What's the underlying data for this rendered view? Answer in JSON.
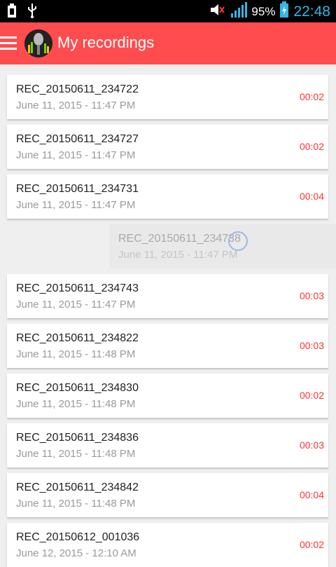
{
  "status_bar": {
    "icons": [
      "usb-storage-icon",
      "usb-icon",
      "mute-icon",
      "signal-icon",
      "battery-charging-icon"
    ],
    "battery_percent": "95%",
    "time": "22:48"
  },
  "appbar": {
    "title": "My recordings",
    "menu_icon": "hamburger-menu-icon",
    "logo_icon": "microphone-logo-icon"
  },
  "recordings": [
    {
      "name": "REC_20150611_234722",
      "date": "June 11, 2015 - 11:47 PM",
      "duration": "00:02"
    },
    {
      "name": "REC_20150611_234727",
      "date": "June 11, 2015 - 11:47 PM",
      "duration": "00:02"
    },
    {
      "name": "REC_20150611_234731",
      "date": "June 11, 2015 - 11:47 PM",
      "duration": "00:04"
    },
    {
      "name": "REC_20150611_234738",
      "date": "June 11, 2015 - 11:47 PM",
      "duration": "",
      "dragging": true
    },
    {
      "name": "REC_20150611_234743",
      "date": "June 11, 2015 - 11:47 PM",
      "duration": "00:03"
    },
    {
      "name": "REC_20150611_234822",
      "date": "June 11, 2015 - 11:48 PM",
      "duration": "00:03"
    },
    {
      "name": "REC_20150611_234830",
      "date": "June 11, 2015 - 11:48 PM",
      "duration": "00:02"
    },
    {
      "name": "REC_20150611_234836",
      "date": "June 11, 2015 - 11:48 PM",
      "duration": "00:03"
    },
    {
      "name": "REC_20150611_234842",
      "date": "June 11, 2015 - 11:48 PM",
      "duration": "00:04"
    },
    {
      "name": "REC_20150612_001036",
      "date": "June 12, 2015 - 12:10 AM",
      "duration": "00:02"
    }
  ],
  "colors": {
    "accent": "#ff4c4f",
    "duration": "#ff3333",
    "clock": "#33b5e5"
  }
}
